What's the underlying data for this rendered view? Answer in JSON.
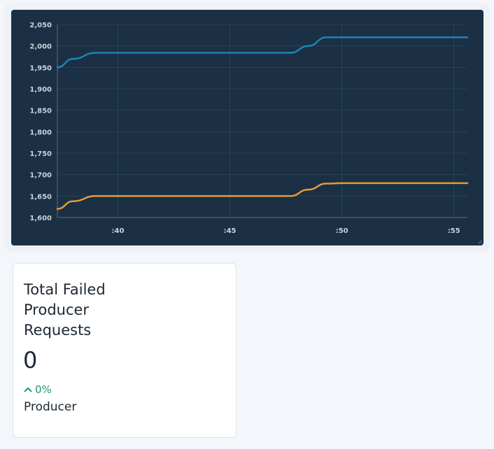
{
  "chart_data": {
    "type": "line",
    "x": [
      37.3,
      38,
      39,
      40,
      45,
      47.7,
      48.5,
      49.3,
      50,
      55,
      55.6
    ],
    "x_ticks": [
      ":40",
      ":45",
      ":50",
      ":55"
    ],
    "y_ticks": [
      "1,600",
      "1,650",
      "1,700",
      "1,750",
      "1,800",
      "1,850",
      "1,900",
      "1,950",
      "2,000",
      "2,050"
    ],
    "ylim": [
      1600,
      2050
    ],
    "grid": true,
    "series": [
      {
        "color": "#1a86b8",
        "values": [
          1950,
          1970,
          1984,
          1984,
          1984,
          1984,
          2000,
          2020,
          2020,
          2020,
          2020
        ]
      },
      {
        "color": "#e69a35",
        "values": [
          1620,
          1638,
          1650,
          1650,
          1650,
          1650,
          1665,
          1679,
          1680,
          1680,
          1680
        ]
      }
    ]
  },
  "card": {
    "title": "Total Failed Producer Requests",
    "value": "0",
    "change": "0%",
    "change_icon": "chevron-up-icon",
    "subtitle": "Producer",
    "change_color": "#1f9a6a"
  }
}
